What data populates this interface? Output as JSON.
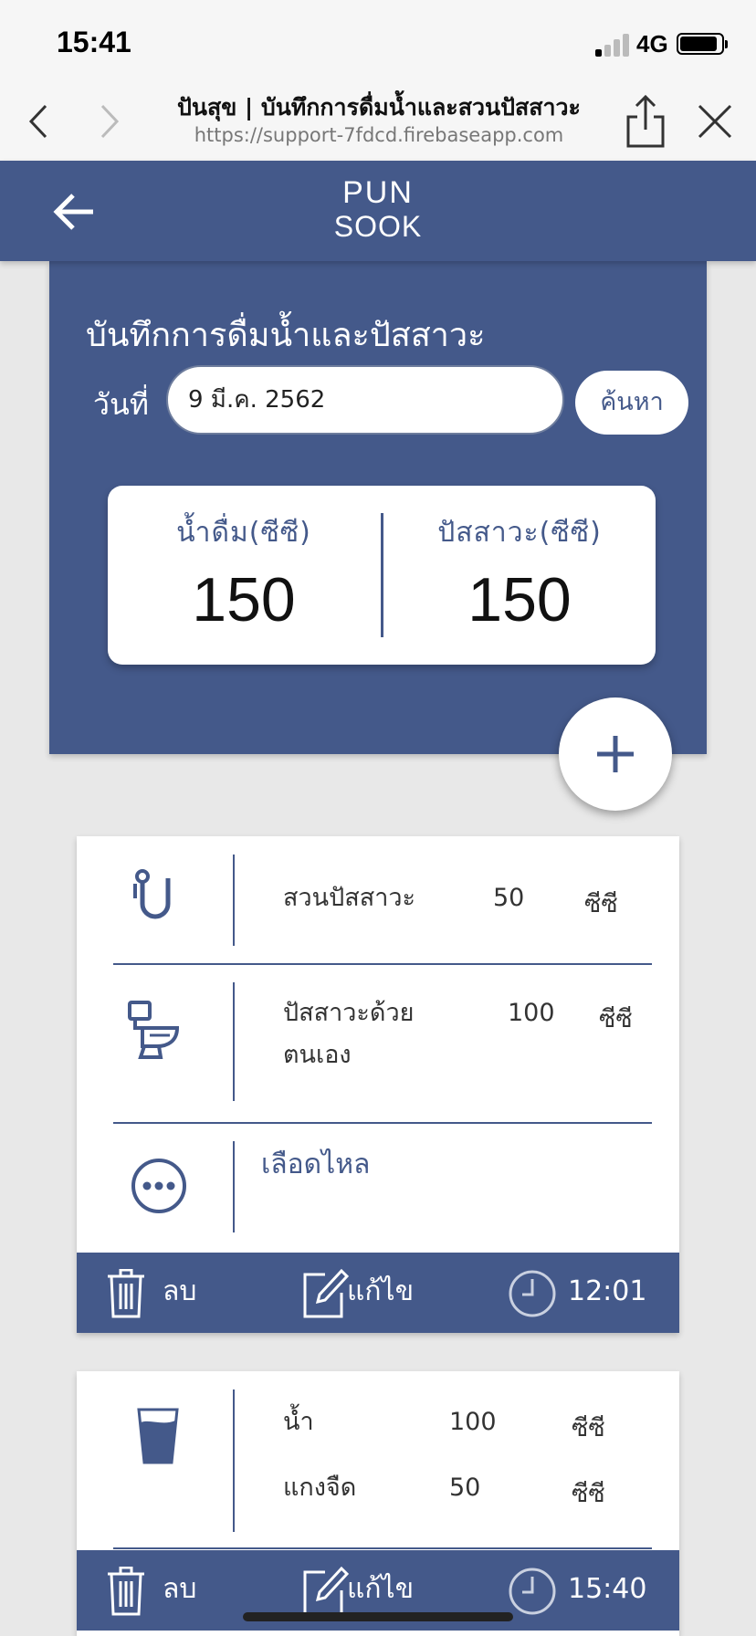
{
  "status_bar": {
    "time": "15:41",
    "network": "4G"
  },
  "browser": {
    "page_title": "ปันสุข | บันทึกการดื่มน้ำและสวนปัสสาวะ",
    "url": "https://support-7fdcd.firebaseapp.com"
  },
  "header": {
    "logo_top": "PUN",
    "logo_bottom": "SOOK"
  },
  "summary": {
    "heading": "บันทึกการดื่มน้ำและปัสสาวะ",
    "date_label": "วันที่",
    "date_value": "9 มี.ค. 2562",
    "search_label": "ค้นหา",
    "drink_label": "น้ำดื่ม(ซีซี)",
    "drink_total": "150",
    "urine_label": "ปัสสาวะ(ซีซี)",
    "urine_total": "150"
  },
  "records": [
    {
      "entries": [
        {
          "icon": "catheter-icon",
          "name": "สวนปัสสาวะ",
          "amount": "50",
          "unit": "ซีซี"
        },
        {
          "icon": "toilet-icon",
          "name_line1": "ปัสสาวะด้วย",
          "name_line2": "ตนเอง",
          "amount": "100",
          "unit": "ซีซี"
        }
      ],
      "note_icon": "more-icon",
      "note": "เลือดไหล",
      "delete_label": "ลบ",
      "edit_label": "แก้ไข",
      "time": "12:01"
    },
    {
      "entries": [
        {
          "icon": "water-glass-icon",
          "name": "น้ำ",
          "amount": "100",
          "unit": "ซีซี"
        },
        {
          "name": "แกงจืด",
          "amount": "50",
          "unit": "ซีซี"
        }
      ],
      "delete_label": "ลบ",
      "edit_label": "แก้ไข",
      "time": "15:40"
    }
  ],
  "colors": {
    "primary": "#44598a",
    "background": "#e8e8e8",
    "card": "#ffffff"
  }
}
